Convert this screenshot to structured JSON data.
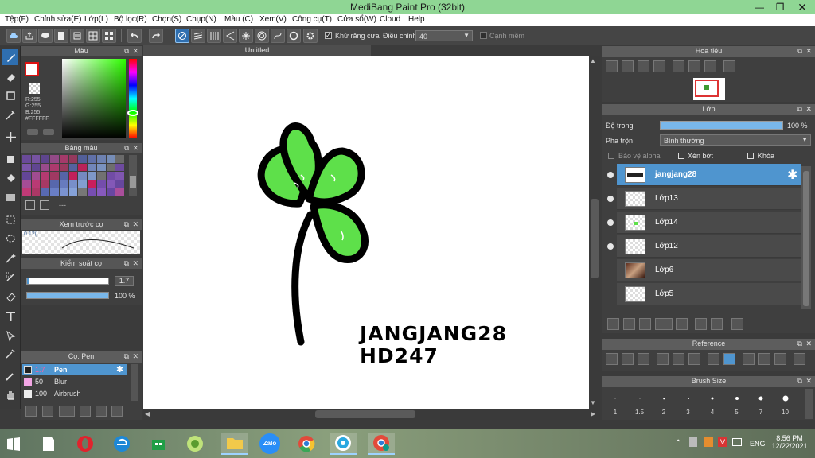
{
  "window": {
    "title": "MediBang Paint Pro (32bit)"
  },
  "menu": [
    "Tệp(F)",
    "Chỉnh sửa(E)",
    "Lớp(L)",
    "Bộ lọc(R)",
    "Chọn(S)",
    "Chụp(N)",
    "Màu (C)",
    "Xem(V)",
    "Công cụ(T)",
    "Cửa sổ(W)",
    "Cloud",
    "Help"
  ],
  "toolbar": {
    "antialias_label": "Khử răng cưa",
    "correction_label": "Điều chỉnh",
    "correction_value": "40",
    "edge_label": "Cạnh mềm"
  },
  "color_panel": {
    "title": "Màu",
    "r": "R:255",
    "g": "G:255",
    "b": "B:255",
    "hex": "#FFFFFF"
  },
  "palette_panel": {
    "title": "Bảng màu",
    "more": "---"
  },
  "brush_preview": {
    "title": "Xem trước cọ",
    "size": "0.12("
  },
  "brush_control": {
    "title": "Kiểm soát cọ",
    "size_value": "1.7",
    "opacity_value": "100 %"
  },
  "brush_list": {
    "title": "Cọ: Pen",
    "items": [
      {
        "size": "1.7",
        "name": "Pen"
      },
      {
        "size": "50",
        "name": "Blur"
      },
      {
        "size": "100",
        "name": "Airbrush"
      }
    ]
  },
  "canvas": {
    "tab_title": "Untitled",
    "text_line1": "JANGJANG28",
    "text_line2": "HD247"
  },
  "navigator": {
    "title": "Hoa tiêu"
  },
  "layer_panel": {
    "title": "Lớp",
    "opacity_label": "Độ trong",
    "opacity_value": "100 %",
    "blend_label": "Pha trộn",
    "blend_value": "Bình thường",
    "protect_alpha": "Bảo vệ alpha",
    "clip": "Xén bớt",
    "lock": "Khóa",
    "layers": [
      "jangjang28",
      "Lớp13",
      "Lớp14",
      "Lớp12",
      "Lớp6",
      "Lớp5"
    ]
  },
  "reference": {
    "title": "Reference"
  },
  "brush_size": {
    "title": "Brush Size",
    "sizes": [
      "1",
      "1.5",
      "2",
      "3",
      "4",
      "5",
      "7",
      "10"
    ]
  },
  "taskbar": {
    "lang": "ENG",
    "time": "8:56 PM",
    "date": "12/22/2021",
    "zalo": "Zalo"
  },
  "colors": {
    "accent": "#4f95cf",
    "titlebar": "#8fd694",
    "clover_fill": "#5ee04a"
  }
}
